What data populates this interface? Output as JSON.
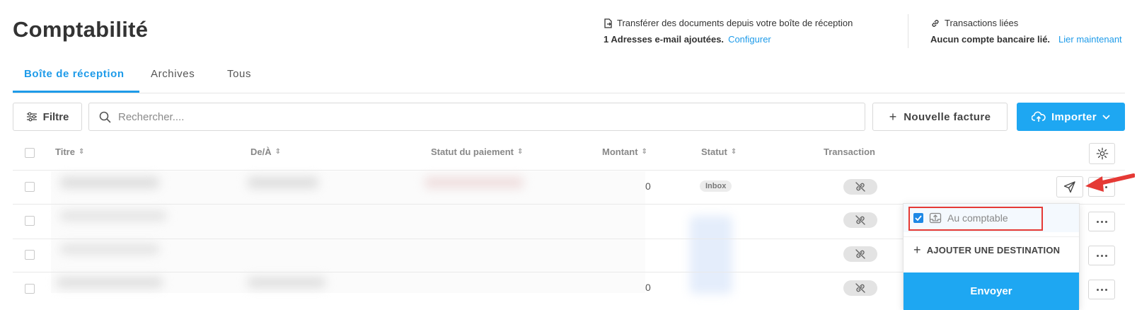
{
  "header": {
    "title": "Comptabilité",
    "transfer": {
      "label": "Transférer des documents depuis votre boîte de réception",
      "status": "1 Adresses e-mail ajoutées.",
      "link": "Configurer"
    },
    "transactions": {
      "label": "Transactions liées",
      "status": "Aucun compte bancaire lié.",
      "link": "Lier maintenant"
    }
  },
  "tabs": [
    {
      "label": "Boîte de réception",
      "active": true
    },
    {
      "label": "Archives",
      "active": false
    },
    {
      "label": "Tous",
      "active": false
    }
  ],
  "toolbar": {
    "filter_label": "Filtre",
    "search_placeholder": "Rechercher....",
    "new_invoice_label": "Nouvelle facture",
    "import_label": "Importer"
  },
  "table": {
    "columns": [
      "Titre",
      "De/À",
      "Statut du paiement",
      "Montant",
      "Statut",
      "Transaction"
    ],
    "rows": [
      {
        "amount_suffix": "0",
        "status": "Inbox"
      },
      {
        "amount_suffix": "",
        "status": ""
      },
      {
        "amount_suffix": "",
        "status": ""
      },
      {
        "amount_suffix": "0",
        "status": ""
      }
    ]
  },
  "dropdown": {
    "option_label": "Au comptable",
    "option_checked": true,
    "add_destination": "AJOUTER UNE DESTINATION",
    "send_label": "Envoyer"
  },
  "colors": {
    "accent": "#1ea7f2",
    "highlight": "#e53935"
  }
}
